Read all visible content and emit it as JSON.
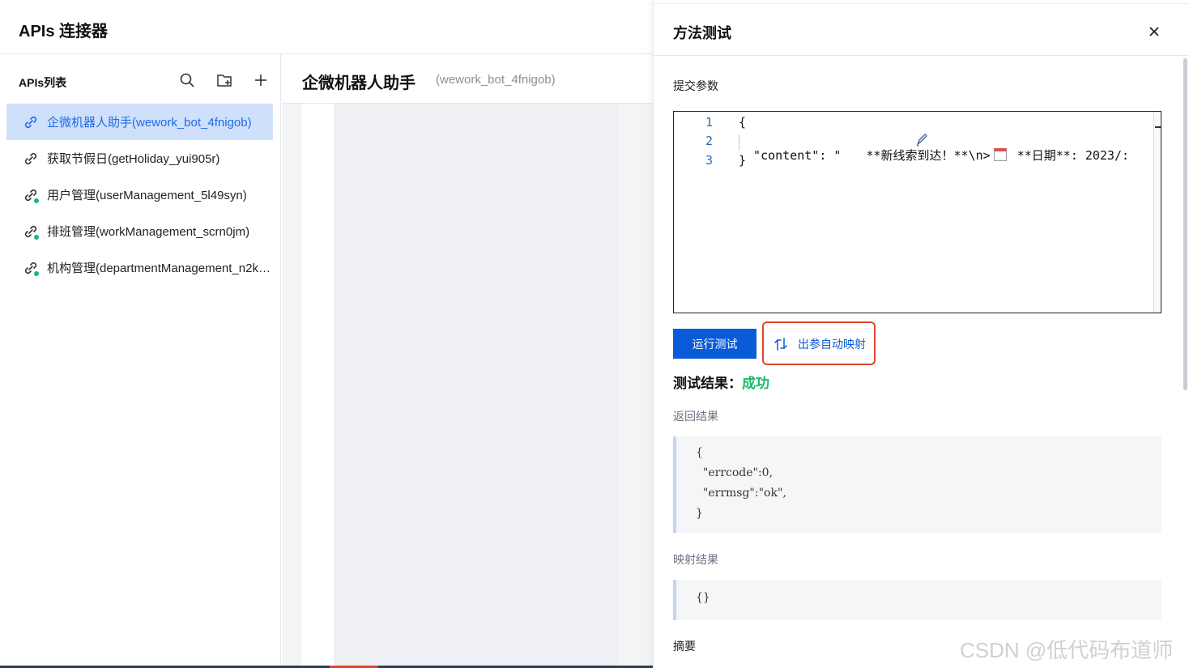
{
  "app": {
    "title": "APIs 连接器"
  },
  "sidebar": {
    "title": "APIs列表",
    "items": [
      {
        "label": "企微机器人助手(wework_bot_4fnigob)",
        "active": true,
        "icon": "link-icon"
      },
      {
        "label": "获取节假日(getHoliday_yui905r)",
        "active": false,
        "icon": "link-icon"
      },
      {
        "label": "用户管理(userManagement_5l49syn)",
        "active": false,
        "icon": "link-check-icon"
      },
      {
        "label": "排班管理(workManagement_scrn0jm)",
        "active": false,
        "icon": "link-check-icon"
      },
      {
        "label": "机构管理(departmentManagement_n2kt…",
        "active": false,
        "icon": "link-check-icon"
      }
    ]
  },
  "content": {
    "title": "企微机器人助手",
    "subtitle": "(wework_bot_4fnigob)"
  },
  "drawer": {
    "title": "方法测试",
    "params_label": "提交参数",
    "editor": {
      "lines": [
        {
          "no": "1",
          "code": "{"
        },
        {
          "no": "2",
          "code_a": "  \"content\": \"",
          "code_b": " **新线索到达！**\\n>",
          "code_c": " **日期**: 2023/:"
        },
        {
          "no": "3",
          "code": "}"
        }
      ]
    },
    "run_button": "运行测试",
    "map_button": "出参自动映射",
    "result_label": "测试结果：",
    "result_status": "成功",
    "return_label": "返回结果",
    "return_lines": [
      "{",
      "  \"errcode\":0,",
      "  \"errmsg\":\"ok\",",
      "}"
    ],
    "mapping_label": "映射结果",
    "mapping_value": "{}",
    "summary_label": "摘要"
  },
  "watermark": "CSDN @低代码布道师",
  "colors": {
    "accent": "#0a5bd8",
    "success": "#19b86d",
    "highlight_border": "#e0462c",
    "active_bg": "#cfe0fa"
  }
}
